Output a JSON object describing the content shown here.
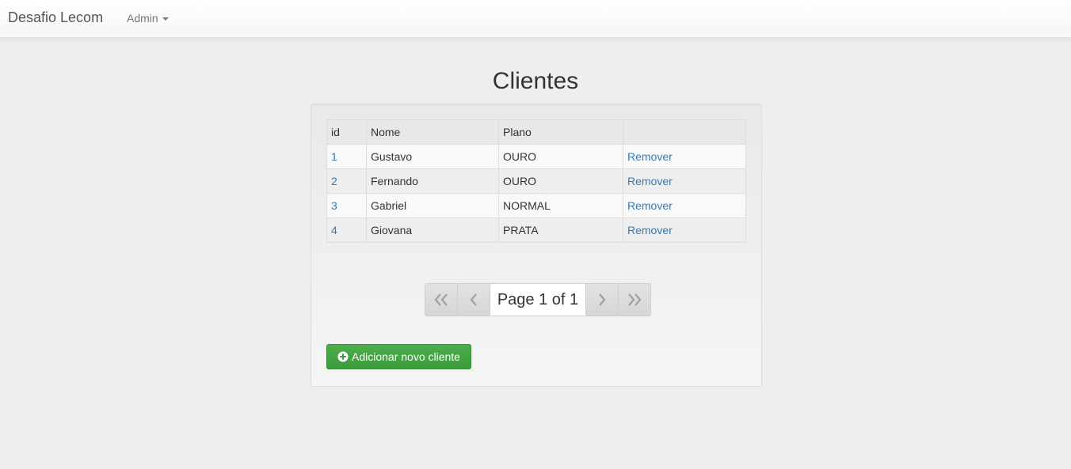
{
  "navbar": {
    "brand": "Desafio Lecom",
    "menu_label": "Admin"
  },
  "page_title": "Clientes",
  "table": {
    "headers": [
      "id",
      "Nome",
      "Plano",
      ""
    ],
    "rows": [
      {
        "id": "1",
        "nome": "Gustavo",
        "plano": "OURO",
        "action": "Remover"
      },
      {
        "id": "2",
        "nome": "Fernando",
        "plano": "OURO",
        "action": "Remover"
      },
      {
        "id": "3",
        "nome": "Gabriel",
        "plano": "NORMAL",
        "action": "Remover"
      },
      {
        "id": "4",
        "nome": "Giovana",
        "plano": "PRATA",
        "action": "Remover"
      }
    ]
  },
  "pager": {
    "info": "Page 1 of 1",
    "first_icon": "double-chevron-left-icon",
    "prev_icon": "chevron-left-icon",
    "next_icon": "chevron-right-icon",
    "last_icon": "double-chevron-right-icon"
  },
  "add_button": {
    "label": "Adicionar novo cliente",
    "icon": "plus-circle-icon"
  },
  "colors": {
    "link": "#337ab7",
    "success": "#449d44",
    "background": "#eeeeee"
  }
}
